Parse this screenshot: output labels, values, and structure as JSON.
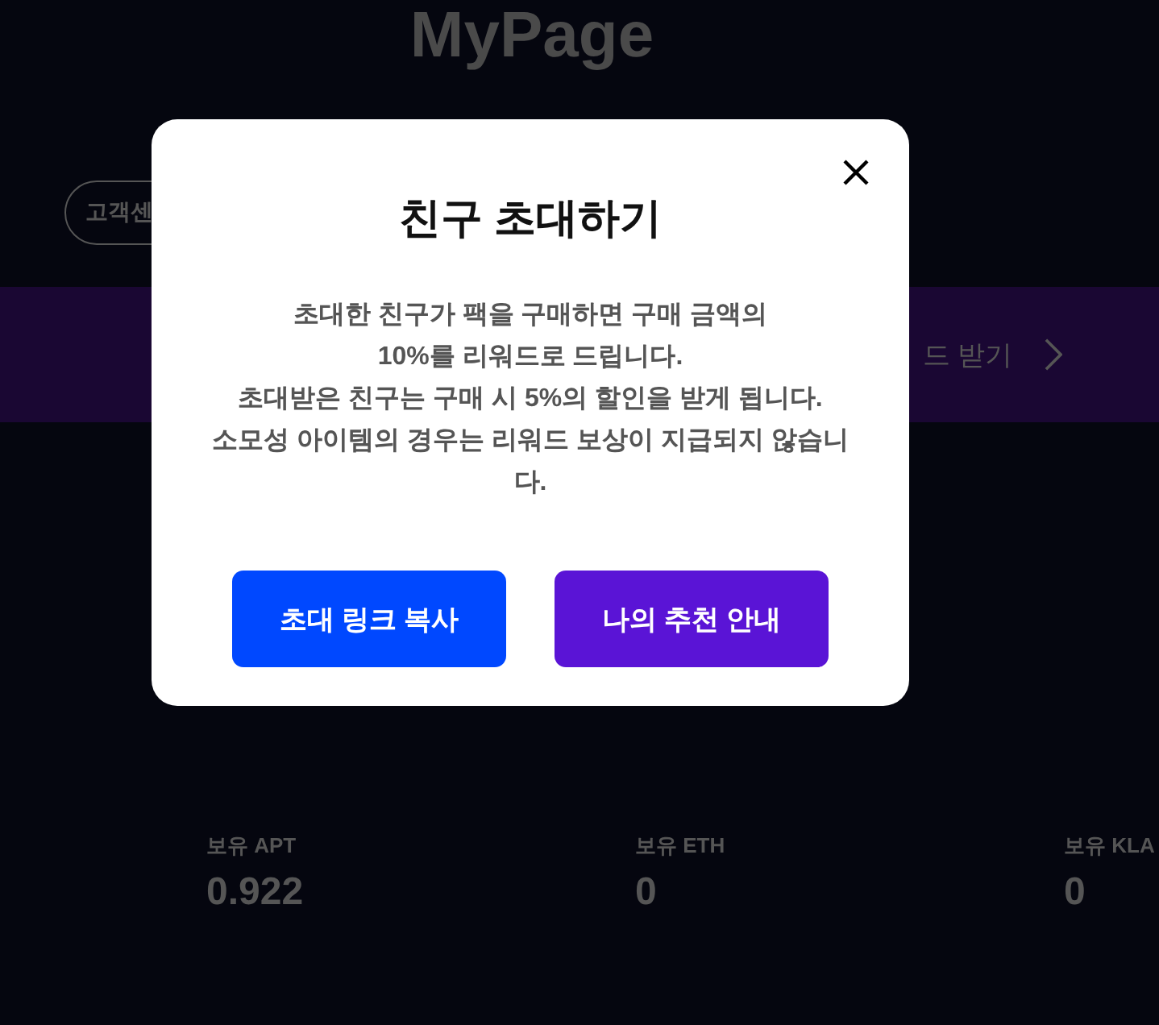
{
  "page": {
    "title": "MyPage",
    "support_button": "고객센",
    "banner": {
      "label": "드 받기"
    },
    "balances": [
      {
        "label": "보유 APT",
        "value": "0.922"
      },
      {
        "label": "보유 ETH",
        "value": "0"
      },
      {
        "label": "보유 KLA",
        "value": "0"
      }
    ]
  },
  "modal": {
    "title": "친구 초대하기",
    "message": "초대한 친구가 팩을 구매하면 구매 금액의\n10%를 리워드로 드립니다.\n초대받은 친구는 구매 시 5%의 할인을 받게 됩니다.\n소모성 아이템의 경우는 리워드 보상이 지급되지 않습니다.",
    "buttons": [
      {
        "label": "초대 링크 복사",
        "kind": "primary"
      },
      {
        "label": "나의 추천 안내",
        "kind": "secondary"
      }
    ]
  }
}
